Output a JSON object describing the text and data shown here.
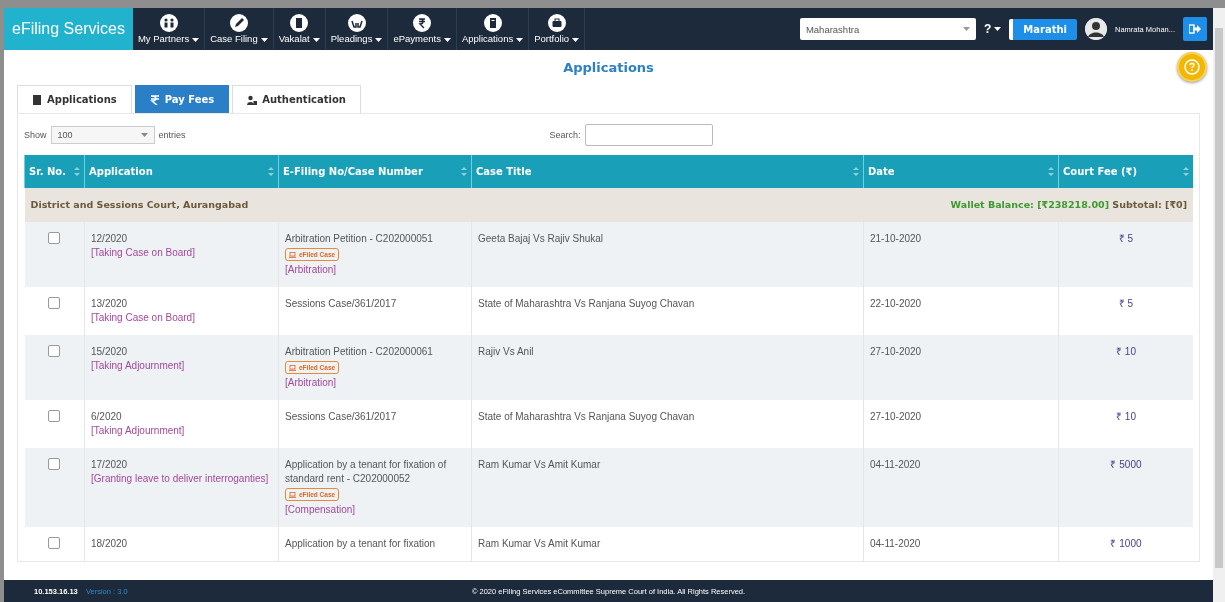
{
  "navbar": {
    "brand": "eFiling Services",
    "menu": [
      {
        "label": "My Partners"
      },
      {
        "label": "Case Filing"
      },
      {
        "label": "Vakalat"
      },
      {
        "label": "Pleadings"
      },
      {
        "label": "ePayments"
      },
      {
        "label": "Applications"
      },
      {
        "label": "Portfolio"
      }
    ],
    "state_select": {
      "value": "Maharashtra"
    },
    "help": "?",
    "language_button": "Marathi",
    "user_name": "Namrata Mohan..."
  },
  "page_title": "Applications",
  "tabs": [
    {
      "label": "Applications",
      "selected": false
    },
    {
      "label": "Pay Fees",
      "selected": true
    },
    {
      "label": "Authentication",
      "selected": false
    }
  ],
  "table_controls": {
    "show_label": "Show",
    "page_size": "100",
    "entries_label": "entries",
    "search_label": "Search:"
  },
  "table": {
    "columns": [
      "Sr. No.",
      "Application",
      "E-Filing No/Case Number",
      "Case Title",
      "Date",
      "Court Fee (₹)"
    ],
    "group": {
      "court": "District and Sessions Court, Aurangabad",
      "wallet": "Wallet Balance: [₹238218.00]",
      "subtotal": "Subtotal: [₹0]"
    },
    "rows": [
      {
        "checked": false,
        "number": "12/2020",
        "application": "[Taking Case on Board]",
        "case_number": "Arbitration Petition - C202000051",
        "badge": "eFiled Case",
        "category": "[Arbitration]",
        "case_title": "Geeta Bajaj Vs Rajiv Shukal",
        "date": "21-10-2020",
        "fee": "₹ 5"
      },
      {
        "checked": false,
        "number": "13/2020",
        "application": "[Taking Case on Board]",
        "case_number": "Sessions Case/361/2017",
        "case_title": "State of Maharashtra Vs Ranjana Suyog Chavan",
        "date": "22-10-2020",
        "fee": "₹ 5"
      },
      {
        "checked": false,
        "number": "15/2020",
        "application": "[Taking Adjournment]",
        "case_number": "Arbitration Petition - C202000061",
        "badge": "eFiled Case",
        "category": "[Arbitration]",
        "case_title": "Rajiv Vs Anil",
        "date": "27-10-2020",
        "fee": "₹ 10"
      },
      {
        "checked": false,
        "number": "6/2020",
        "application": "[Taking Adjournment]",
        "case_number": "Sessions Case/361/2017",
        "case_title": "State of Maharashtra Vs Ranjana Suyog Chavan",
        "date": "27-10-2020",
        "fee": "₹ 10"
      },
      {
        "checked": false,
        "number": "17/2020",
        "application": "[Granting leave to deliver interroganties]",
        "case_number": "Application by a tenant for fixation of standard rent - C202000052",
        "badge": "eFiled Case",
        "category": "[Compensation]",
        "case_title": "Ram Kumar Vs Amit Kumar",
        "date": "04-11-2020",
        "fee": "₹ 5000"
      },
      {
        "checked": false,
        "number": "18/2020",
        "case_number": "Application by a tenant for fixation",
        "case_title": "Ram Kumar Vs Amit Kumar",
        "date": "04-11-2020",
        "fee": "₹ 1000"
      }
    ]
  },
  "footer": {
    "ip": "10.153.16.13",
    "version": "Version : 3.0",
    "copyright": "© 2020 eFiling Services eCommittee Supreme Court of India. All Rights Reserved."
  }
}
